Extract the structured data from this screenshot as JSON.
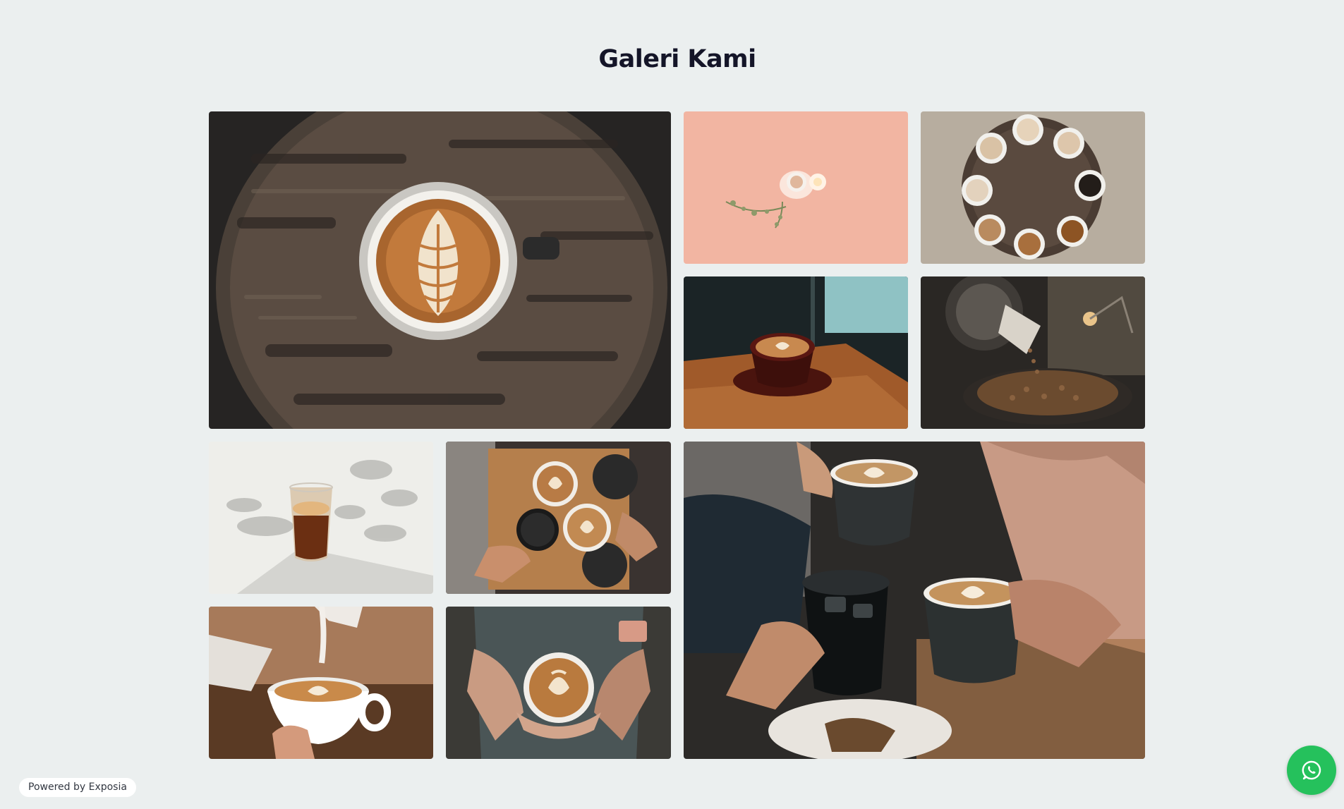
{
  "gallery": {
    "title": "Galeri Kami",
    "photos": [
      {
        "icon": "latte-art-on-round-wooden-table-photo"
      },
      {
        "icon": "cup-on-peach-background-photo"
      },
      {
        "icon": "coffee-cups-circle-on-wood-table-photo"
      },
      {
        "icon": "latte-cup-on-cafe-table-photo"
      },
      {
        "icon": "coffee-roaster-machine-photo"
      },
      {
        "icon": "iced-coffee-glass-in-sunlight-photo"
      },
      {
        "icon": "hands-holding-coffees-top-view-photo"
      },
      {
        "icon": "friends-toasting-coffee-cups-photo"
      },
      {
        "icon": "milk-pour-latte-art-photo"
      },
      {
        "icon": "hands-holding-latte-photo"
      }
    ]
  },
  "footer": {
    "powered_by": "Powered by Exposia"
  },
  "whatsapp": {
    "icon": "whatsapp-icon",
    "color": "#25c15c"
  },
  "colors": {
    "background": "#ebefef",
    "title": "#141528"
  }
}
